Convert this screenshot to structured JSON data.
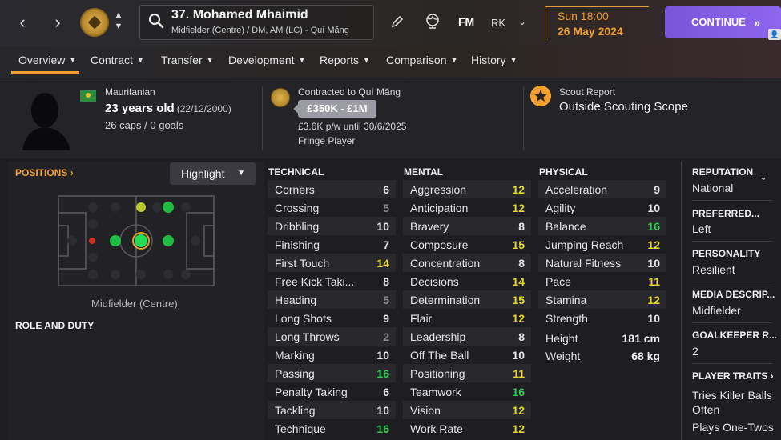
{
  "header": {
    "player_title": "37. Mohamed Mhaimid",
    "player_subtitle": "Midfielder (Centre) / DM, AM (LC) - Quí Măng",
    "fm_label": "FM",
    "rk_label": "RK",
    "date_time": "Sun 18:00",
    "date_day": "26 May 2024",
    "continue_label": "CONTINUE"
  },
  "tabs": [
    {
      "label": "Overview"
    },
    {
      "label": "Contract"
    },
    {
      "label": "Transfer"
    },
    {
      "label": "Development"
    },
    {
      "label": "Reports"
    },
    {
      "label": "Comparison"
    },
    {
      "label": "History"
    }
  ],
  "info": {
    "nationality": "Mauritanian",
    "age": "23 years old",
    "dob": "(22/12/2000)",
    "caps": "26 caps / 0 goals",
    "contract_to": "Contracted to Quí Măng",
    "value": "£350K - £1M",
    "wage": "£3.6K p/w until 30/6/2025",
    "squad_status": "Fringe Player",
    "scout_title": "Scout Report",
    "scout_value": "Outside Scouting Scope"
  },
  "positions": {
    "link_label": "POSITIONS",
    "highlight_label": "Highlight",
    "position_label": "Midfielder (Centre)",
    "role_title": "ROLE AND DUTY"
  },
  "columns": {
    "technical": "TECHNICAL",
    "mental": "MENTAL",
    "physical": "PHYSICAL"
  },
  "technical": [
    {
      "name": "Corners",
      "value": "6"
    },
    {
      "name": "Crossing",
      "value": "5"
    },
    {
      "name": "Dribbling",
      "value": "10"
    },
    {
      "name": "Finishing",
      "value": "7"
    },
    {
      "name": "First Touch",
      "value": "14"
    },
    {
      "name": "Free Kick Taki...",
      "value": "8"
    },
    {
      "name": "Heading",
      "value": "5"
    },
    {
      "name": "Long Shots",
      "value": "9"
    },
    {
      "name": "Long Throws",
      "value": "2"
    },
    {
      "name": "Marking",
      "value": "10"
    },
    {
      "name": "Passing",
      "value": "16"
    },
    {
      "name": "Penalty Taking",
      "value": "6"
    },
    {
      "name": "Tackling",
      "value": "10"
    },
    {
      "name": "Technique",
      "value": "16"
    }
  ],
  "mental": [
    {
      "name": "Aggression",
      "value": "12"
    },
    {
      "name": "Anticipation",
      "value": "12"
    },
    {
      "name": "Bravery",
      "value": "8"
    },
    {
      "name": "Composure",
      "value": "15"
    },
    {
      "name": "Concentration",
      "value": "8"
    },
    {
      "name": "Decisions",
      "value": "14"
    },
    {
      "name": "Determination",
      "value": "15"
    },
    {
      "name": "Flair",
      "value": "12"
    },
    {
      "name": "Leadership",
      "value": "8"
    },
    {
      "name": "Off The Ball",
      "value": "10"
    },
    {
      "name": "Positioning",
      "value": "11"
    },
    {
      "name": "Teamwork",
      "value": "16"
    },
    {
      "name": "Vision",
      "value": "12"
    },
    {
      "name": "Work Rate",
      "value": "12"
    }
  ],
  "physical": [
    {
      "name": "Acceleration",
      "value": "9"
    },
    {
      "name": "Agility",
      "value": "10"
    },
    {
      "name": "Balance",
      "value": "16"
    },
    {
      "name": "Jumping Reach",
      "value": "12"
    },
    {
      "name": "Natural Fitness",
      "value": "10"
    },
    {
      "name": "Pace",
      "value": "11"
    },
    {
      "name": "Stamina",
      "value": "12"
    },
    {
      "name": "Strength",
      "value": "10"
    }
  ],
  "physical_extra": [
    {
      "name": "Height",
      "value": "181 cm"
    },
    {
      "name": "Weight",
      "value": "68 kg"
    }
  ],
  "right_panel": {
    "reputation_title": "REPUTATION",
    "reputation_value": "National",
    "preferred_title": "PREFERRED...",
    "preferred_value": "Left",
    "personality_title": "PERSONALITY",
    "personality_value": "Resilient",
    "media_title": "MEDIA DESCRIP...",
    "media_value": "Midfielder",
    "gk_title": "GOALKEEPER R...",
    "gk_value": "2",
    "traits_title": "PLAYER TRAITS",
    "trait_1a": "Tries Killer Balls",
    "trait_1b": "Often",
    "trait_2": "Plays One-Twos"
  },
  "colors": {
    "accent": "#f0a030",
    "continue": "#8e66ee",
    "good": "#33cc55",
    "mid": "#e8d830"
  }
}
